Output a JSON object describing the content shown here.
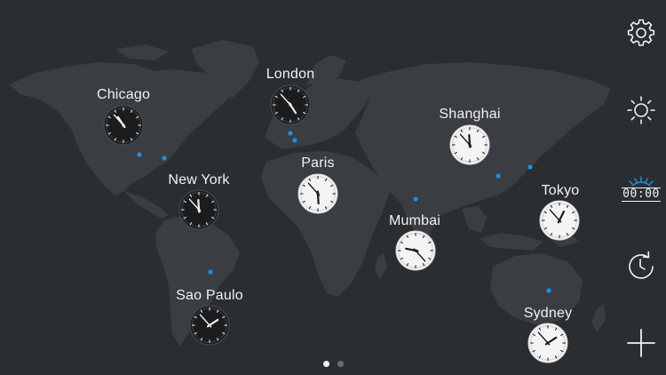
{
  "cities": [
    {
      "name": "Chicago",
      "theme": "dark",
      "hour": 10,
      "minute": 53
    },
    {
      "name": "London",
      "theme": "dark",
      "hour": 4,
      "minute": 53
    },
    {
      "name": "Paris",
      "theme": "light",
      "hour": 5,
      "minute": 53
    },
    {
      "name": "Shanghai",
      "theme": "light",
      "hour": 11,
      "minute": 53
    },
    {
      "name": "New York",
      "theme": "dark",
      "hour": 11,
      "minute": 53
    },
    {
      "name": "Tokyo",
      "theme": "light",
      "hour": 12,
      "minute": 53
    },
    {
      "name": "Mumbai",
      "theme": "light",
      "hour": 9,
      "minute": 23
    },
    {
      "name": "Sao Paulo",
      "theme": "dark",
      "hour": 1,
      "minute": 53
    },
    {
      "name": "Sydney",
      "theme": "light",
      "hour": 1,
      "minute": 53
    }
  ],
  "sidebar": {
    "settings_icon": "gear-icon",
    "brightness_icon": "sun-icon",
    "alarm_icon": "digital-alarm-icon",
    "alarm_display": "00:00",
    "sync_icon": "clock-refresh-icon",
    "add_icon": "plus-icon"
  },
  "pager": {
    "pages": 2,
    "active": 0
  },
  "colors": {
    "background": "#2b2e31",
    "land": "#3a3d41",
    "accent": "#1f8fe0",
    "clock_dark_face": "#1b1c1e",
    "clock_light_face": "#f4f4f4"
  }
}
